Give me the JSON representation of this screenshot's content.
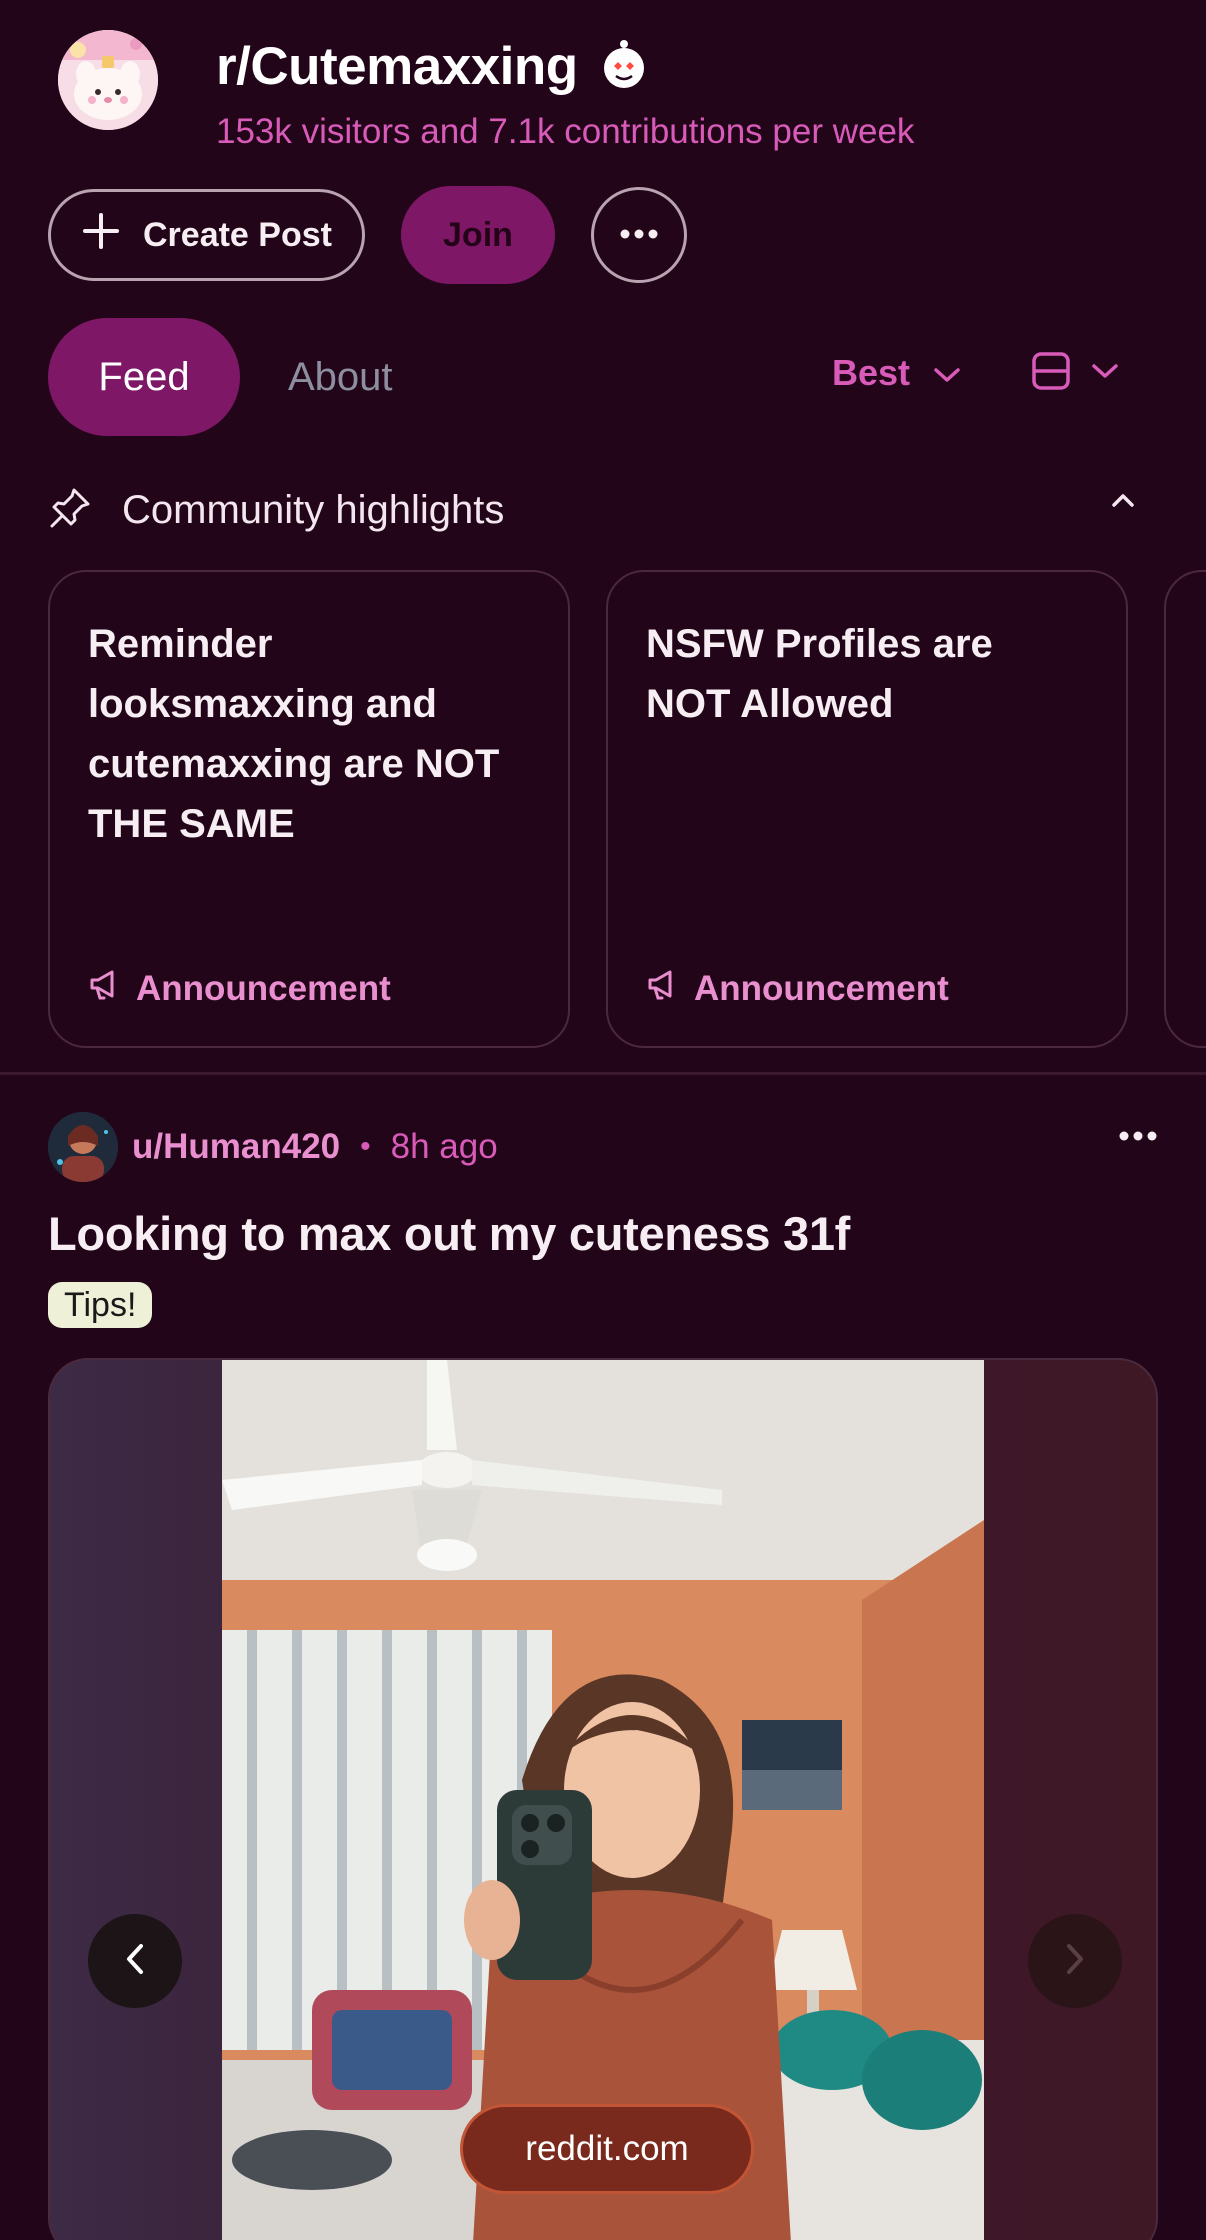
{
  "subreddit": {
    "name": "r/Cutemaxxing",
    "stats": "153k visitors and 7.1k contributions per week"
  },
  "actions": {
    "create_post_label": "Create Post",
    "join_label": "Join"
  },
  "tabs": [
    {
      "label": "Feed",
      "active": true
    },
    {
      "label": "About",
      "active": false
    }
  ],
  "sort": {
    "label": "Best"
  },
  "highlights": {
    "title": "Community highlights",
    "cards": [
      {
        "title": "Reminder looksmaxxing and cutemaxxing are NOT THE SAME",
        "tag": "Announcement"
      },
      {
        "title": "NSFW Profiles are NOT Allowed",
        "tag": "Announcement"
      }
    ]
  },
  "post": {
    "author": "u/Human420",
    "separator": "•",
    "time": "8h ago",
    "title": "Looking to max out my cuteness 31f",
    "flair": "Tips!",
    "link_pill": "reddit.com"
  },
  "colors": {
    "background": "#230519",
    "accent": "#7e1766",
    "pink_text": "#d95bb9",
    "flair_bg": "#eef0d7"
  },
  "icons": [
    "plus-icon",
    "more-icon",
    "chevron-down-icon",
    "card-view-icon",
    "pin-icon",
    "chevron-up-icon",
    "megaphone-icon",
    "chevron-left-icon",
    "chevron-right-icon",
    "reddit-snoo-icon"
  ]
}
